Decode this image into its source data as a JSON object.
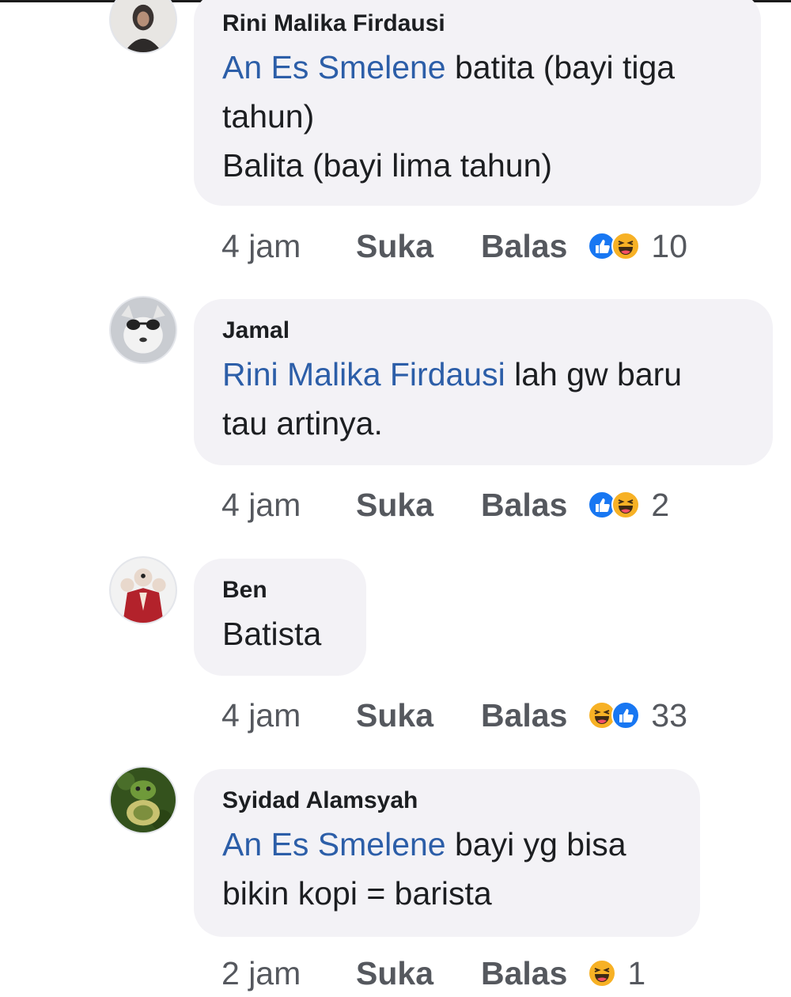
{
  "comments": [
    {
      "name": "Rini Malika Firdausi",
      "line1_mention": "An Es Smelene",
      "line1_rest": " batita (bayi tiga",
      "line2": "tahun)",
      "line3": "Balita (bayi lima tahun)",
      "time": "4 jam",
      "like": "Suka",
      "reply": "Balas",
      "reactions": [
        "like-icon",
        "haha-icon"
      ],
      "count": "10"
    },
    {
      "name": "Jamal",
      "line1_mention": "Rini Malika Firdausi",
      "line1_rest": " lah gw baru",
      "line2": "tau artinya.",
      "time": "4 jam",
      "like": "Suka",
      "reply": "Balas",
      "reactions": [
        "like-icon",
        "haha-icon"
      ],
      "count": "2"
    },
    {
      "name": "Ben",
      "line1": "Batista",
      "time": "4 jam",
      "like": "Suka",
      "reply": "Balas",
      "reactions": [
        "haha-icon",
        "like-icon"
      ],
      "count": "33"
    },
    {
      "name": "Syidad Alamsyah",
      "line1_mention": "An Es Smelene",
      "line1_rest": " bayi yg bisa",
      "line2": "bikin kopi = barista",
      "time": "2 jam",
      "like": "Suka",
      "reply": "Balas",
      "reactions": [
        "haha-icon"
      ],
      "count": "1"
    }
  ],
  "colors": {
    "bubble": "#f3f2f6",
    "mention": "#2c5ea8",
    "meta": "#55585e",
    "like_reaction": "#1877f2",
    "haha_reaction": "#f7b125"
  }
}
